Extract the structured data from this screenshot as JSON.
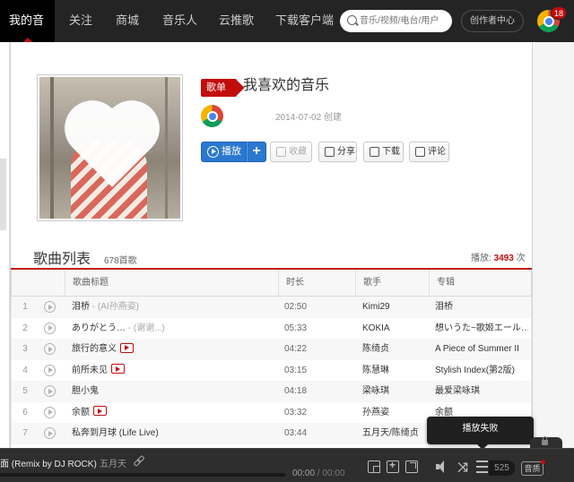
{
  "topnav": {
    "items": [
      "我的音乐",
      "关注",
      "商城",
      "音乐人",
      "云推歌",
      "下载客户端"
    ],
    "active_index": 0,
    "search_placeholder": "音乐/视频/电台/用户",
    "creator_center": "创作者中心",
    "notification_count": "18",
    "avatar_icon": "chrome-logo-icon"
  },
  "playlist": {
    "tag": "歌单",
    "title": "我喜欢的音乐",
    "owner_avatar_icon": "chrome-logo-icon",
    "created_date": "2014-07-02",
    "created_label": "创建",
    "buttons": {
      "play": "播放",
      "add": "+",
      "collect": "收藏",
      "share": "分享",
      "download": "下载",
      "comment": "评论"
    }
  },
  "songlist": {
    "title": "歌曲列表",
    "count": "678首歌",
    "play_label": "播放:",
    "play_count": "3493",
    "play_unit": "次",
    "headers": [
      "歌曲标题",
      "时长",
      "歌手",
      "专辑"
    ],
    "rows": [
      {
        "idx": "1",
        "title": "泪桥",
        "alias": " - (AI孙燕姿)",
        "mv": false,
        "duration": "02:50",
        "artist": "Kimi29",
        "album": "泪桥"
      },
      {
        "idx": "2",
        "title": "ありがとう…",
        "alias": " - (谢谢...)",
        "mv": false,
        "duration": "05:33",
        "artist": "KOKIA",
        "album": "想いうた~歌姬エール…"
      },
      {
        "idx": "3",
        "title": "旅行的意义",
        "alias": "",
        "mv": true,
        "duration": "04:22",
        "artist": "陈绮贞",
        "album": "A Piece of Summer II"
      },
      {
        "idx": "4",
        "title": "前所未见",
        "alias": "",
        "mv": true,
        "duration": "03:15",
        "artist": "陈慧琳",
        "album": "Stylish Index(第2版)"
      },
      {
        "idx": "5",
        "title": "胆小鬼",
        "alias": "",
        "mv": false,
        "duration": "04:18",
        "artist": "梁咏琪",
        "album": "最爱梁咏琪"
      },
      {
        "idx": "6",
        "title": "余额",
        "alias": "",
        "mv": true,
        "duration": "03:32",
        "artist": "孙燕姿",
        "album": "余额"
      },
      {
        "idx": "7",
        "title": "私奔到月球 (Life Live)",
        "alias": "",
        "mv": false,
        "duration": "03:44",
        "artist": "五月天/陈绮贞",
        "album": ""
      }
    ]
  },
  "player": {
    "now_playing_title": "面 (Remix by DJ ROCK)",
    "now_playing_artist": "五月天",
    "progress": 0,
    "current_time": "00:00",
    "separator": " / ",
    "total_time": "00:00",
    "playlist_count": "525",
    "quality_label": "音质",
    "toast": "播放失败"
  },
  "colors": {
    "brand_red": "#c20c0c",
    "topbar_bg": "#242424",
    "play_blue": "#2b78d0",
    "player_bg": "#2e2e2e"
  }
}
